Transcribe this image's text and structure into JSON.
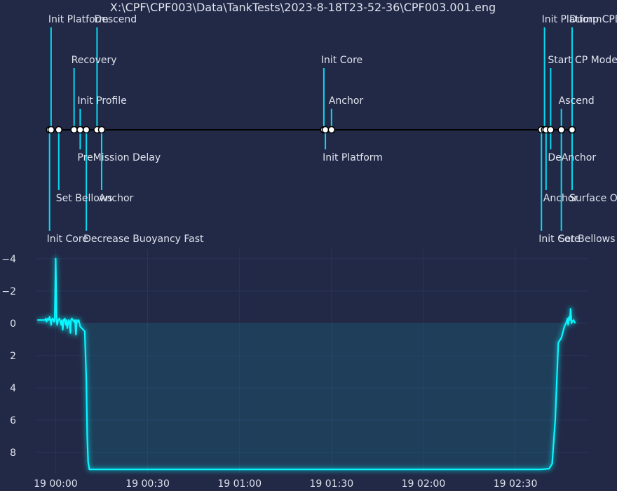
{
  "chart_data": [
    {
      "type": "timeline",
      "title": "X:\\CPF\\CPF003\\Data\\TankTests\\2023-8-18T23-52-36\\CPF003.001.eng",
      "events": [
        {
          "label": "Init Core",
          "t": -2.0,
          "level": -3
        },
        {
          "label": "Init Platform",
          "t": -1.5,
          "level": 3
        },
        {
          "label": "Set Bellows",
          "t": 1.0,
          "level": -2
        },
        {
          "label": "Recovery",
          "t": 6.0,
          "level": 2
        },
        {
          "label": "PreMission Delay",
          "t": 8.0,
          "level": -1
        },
        {
          "label": "Init Profile",
          "t": 8.0,
          "level": 1
        },
        {
          "label": "Decrease Buoyancy Fast",
          "t": 10.0,
          "level": -3
        },
        {
          "label": "Descend",
          "t": 13.5,
          "level": 3
        },
        {
          "label": "Anchor",
          "t": 15.0,
          "level": -2
        },
        {
          "label": "Init Core",
          "t": 87.5,
          "level": 2
        },
        {
          "label": "Init Platform",
          "t": 88.0,
          "level": -1
        },
        {
          "label": "Anchor",
          "t": 90.0,
          "level": 1
        },
        {
          "label": "Init Core",
          "t": 158.5,
          "level": -3
        },
        {
          "label": "Init Platform",
          "t": 159.5,
          "level": 3
        },
        {
          "label": "Anchor",
          "t": 160.0,
          "level": -2
        },
        {
          "label": "Start CP Mode",
          "t": 161.5,
          "level": 2
        },
        {
          "label": "DeAnchor",
          "t": 161.5,
          "level": -1
        },
        {
          "label": "Set Bellows",
          "t": 165.0,
          "level": -3
        },
        {
          "label": "Ascend",
          "t": 165.0,
          "level": 1
        },
        {
          "label": "Surface Ops",
          "t": 168.5,
          "level": -2
        },
        {
          "label": "Dump CPData",
          "t": 168.5,
          "level": 3
        }
      ]
    },
    {
      "type": "line",
      "xlabel": "",
      "ylabel": "",
      "x_ticks": [
        "19 00:00",
        "19 00:30",
        "19 01:00",
        "19 01:30",
        "19 02:00",
        "19 02:30"
      ],
      "y_ticks": [
        "−4",
        "−2",
        "0",
        "2",
        "4",
        "6",
        "8"
      ],
      "xlim": [
        -6.5,
        174
      ],
      "ylim": [
        9.3,
        -4.6
      ],
      "y_inverted": true,
      "grid": true,
      "fill_to_zero": true,
      "series": [
        {
          "x": [
            -6.0,
            -3.5,
            -3.2,
            -3.0,
            -2.5,
            -2.2,
            -2.0,
            -1.7,
            -1.5,
            -1.3,
            -1.0,
            -0.5,
            -0.3,
            0.0,
            0.3,
            0.5,
            0.8,
            1.2,
            1.5,
            1.8,
            2.0,
            2.3,
            2.6,
            3.0,
            3.3,
            3.5,
            3.8,
            4.2,
            4.5,
            4.8,
            5.0,
            5.3,
            5.6,
            6.0,
            6.3,
            6.6,
            6.9,
            7.2,
            7.5,
            8.0,
            9.5,
            10.0,
            10.3,
            10.6,
            11.0,
            158.5,
            161.0,
            162.0,
            163.0,
            164.0,
            165.0,
            166.0,
            166.5,
            167.0,
            167.2,
            167.5,
            167.8,
            168.0,
            168.3,
            168.5,
            169.0,
            169.5
          ],
          "y": [
            -0.2,
            -0.2,
            -0.3,
            -0.1,
            -0.3,
            -0.2,
            -0.4,
            -0.2,
            0.1,
            -0.2,
            -0.3,
            -0.1,
            -0.3,
            -4.0,
            -0.2,
            0.1,
            -0.2,
            -0.3,
            -0.1,
            0.1,
            -0.2,
            0.4,
            -0.2,
            -0.3,
            0.1,
            -0.2,
            0.3,
            -0.2,
            -0.1,
            0.6,
            -0.2,
            -0.3,
            -0.2,
            -0.1,
            -0.2,
            0.7,
            -0.2,
            -0.1,
            -0.2,
            0.2,
            0.5,
            3.5,
            7.0,
            8.6,
            9.05,
            9.05,
            9.0,
            8.7,
            6.0,
            1.2,
            0.9,
            0.2,
            0.0,
            -0.3,
            0.1,
            -0.4,
            -0.2,
            -0.9,
            0.0,
            -0.1,
            -0.2,
            0.0
          ]
        }
      ]
    }
  ]
}
